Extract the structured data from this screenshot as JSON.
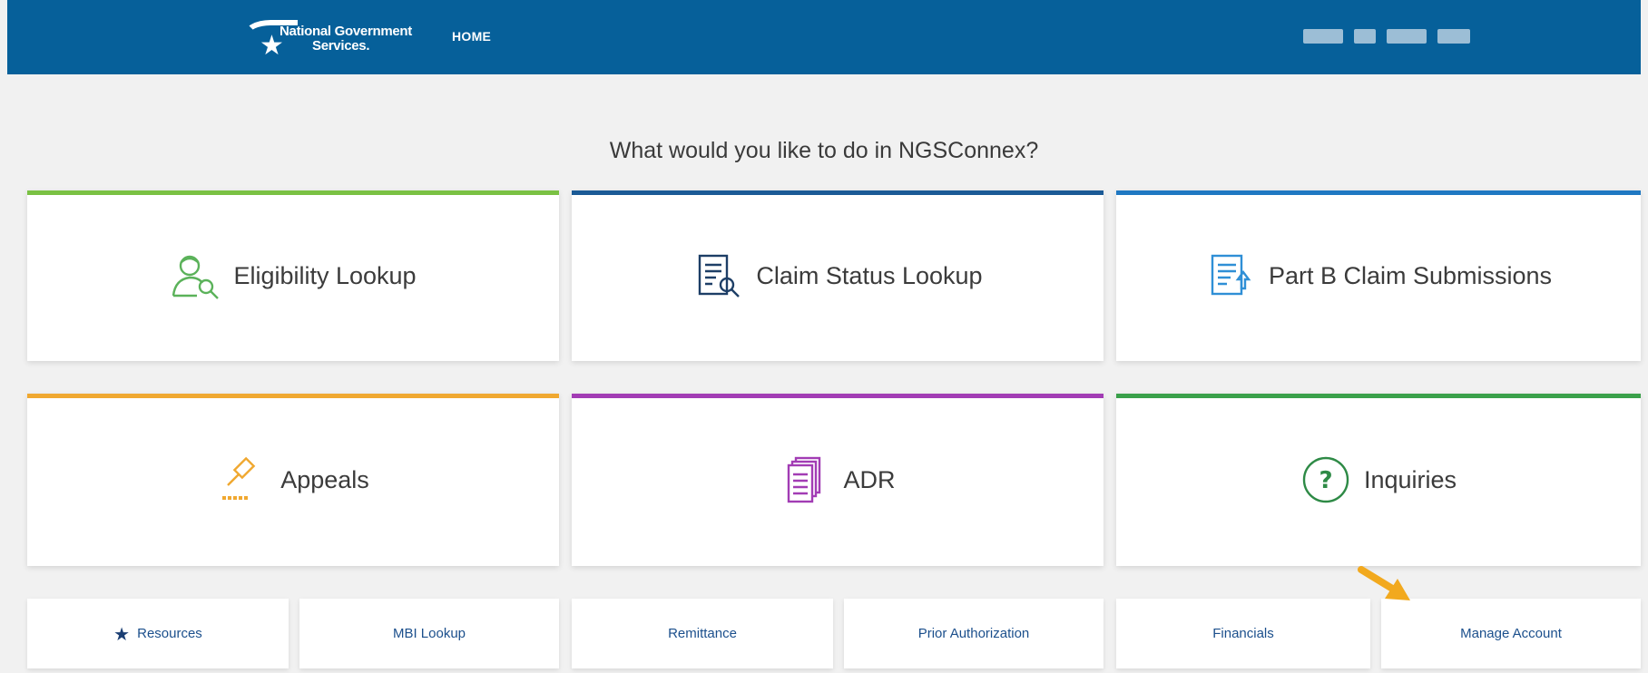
{
  "header": {
    "logo_line1": "National Government",
    "logo_line2": "Services.",
    "nav_home": "HOME",
    "bg_color": "#06609a"
  },
  "prompt": "What would you like to do in NGSConnex?",
  "tiles": [
    {
      "label": "Eligibility Lookup",
      "icon": "person-search-icon",
      "color": "#7ac143"
    },
    {
      "label": "Claim Status Lookup",
      "icon": "document-search-icon",
      "color": "#1b5a96"
    },
    {
      "label": "Part B Claim Submissions",
      "icon": "document-upload-icon",
      "color": "#1f78c2"
    },
    {
      "label": "Appeals",
      "icon": "gavel-icon",
      "color": "#f0a830"
    },
    {
      "label": "ADR",
      "icon": "documents-stack-icon",
      "color": "#a23cb4"
    },
    {
      "label": "Inquiries",
      "icon": "question-circle-icon",
      "color": "#3aa04a"
    }
  ],
  "bottom_buttons": [
    {
      "label": "Resources",
      "icon": "star-icon"
    },
    {
      "label": "MBI Lookup"
    },
    {
      "label": "Remittance"
    },
    {
      "label": "Prior Authorization"
    },
    {
      "label": "Financials"
    },
    {
      "label": "Manage Account"
    }
  ],
  "arrow_color": "#f2a91e"
}
